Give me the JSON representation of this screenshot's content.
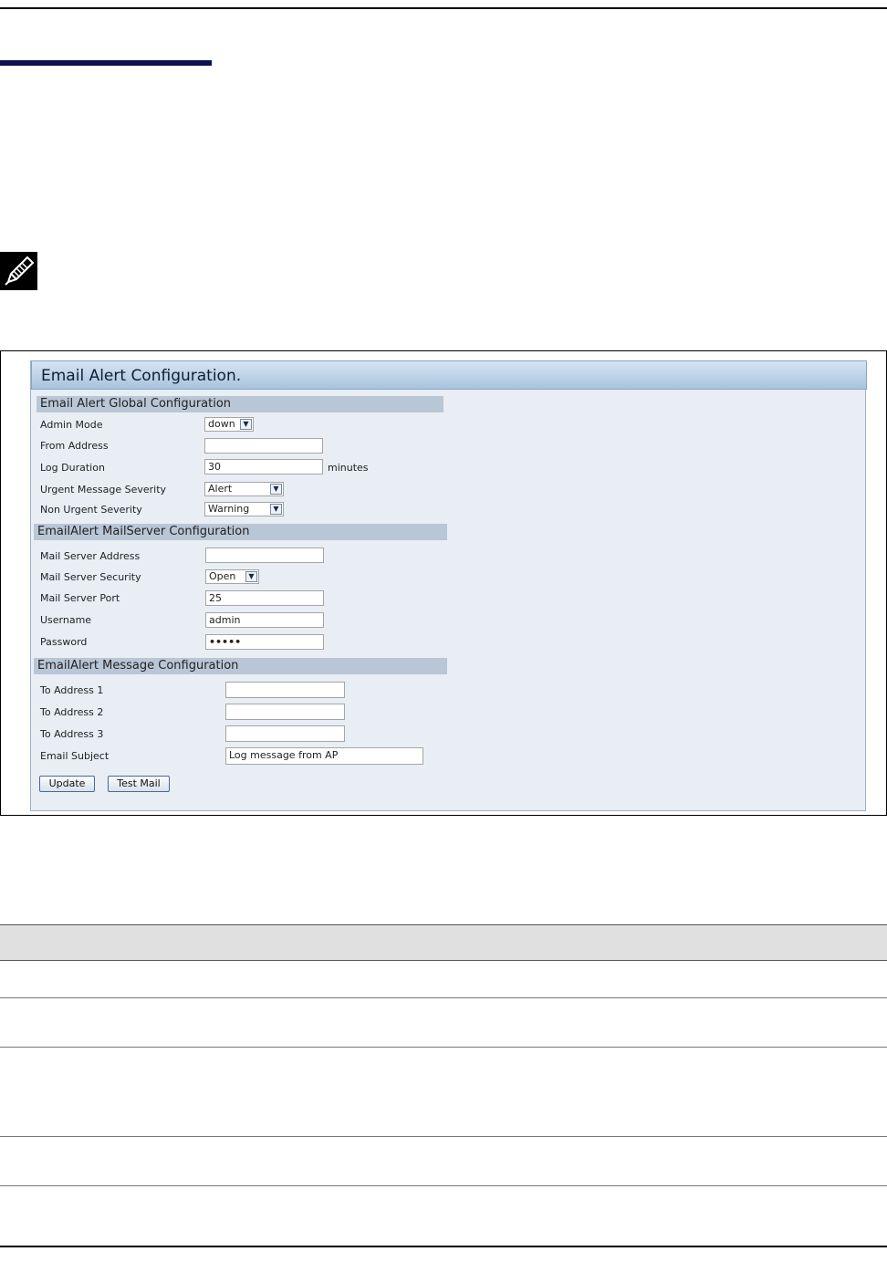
{
  "panel": {
    "title": "Email Alert Configuration."
  },
  "global_config": {
    "heading": "Email Alert Global Configuration",
    "admin_mode": {
      "label": "Admin Mode",
      "value": "down"
    },
    "from_address": {
      "label": "From Address",
      "value": ""
    },
    "log_duration": {
      "label": "Log Duration",
      "value": "30",
      "unit": "minutes"
    },
    "urgent_severity": {
      "label": "Urgent Message Severity",
      "value": "Alert"
    },
    "non_urgent_severity": {
      "label": "Non Urgent Severity",
      "value": "Warning"
    }
  },
  "mailserver_config": {
    "heading": "EmailAlert MailServer Configuration",
    "address": {
      "label": "Mail Server Address",
      "value": ""
    },
    "security": {
      "label": "Mail Server Security",
      "value": "Open"
    },
    "port": {
      "label": "Mail Server Port",
      "value": "25"
    },
    "username": {
      "label": "Username",
      "value": "admin"
    },
    "password": {
      "label": "Password",
      "value": "•••••"
    }
  },
  "message_config": {
    "heading": "EmailAlert Message Configuration",
    "to1": {
      "label": "To Address 1",
      "value": ""
    },
    "to2": {
      "label": "To Address 2",
      "value": ""
    },
    "to3": {
      "label": "To Address 3",
      "value": ""
    },
    "subject": {
      "label": "Email Subject",
      "value": "Log message from AP"
    }
  },
  "buttons": {
    "update": "Update",
    "test_mail": "Test Mail"
  },
  "icons": {
    "note": "note-pencil-icon",
    "dropdown": "chevron-down-icon"
  },
  "colors": {
    "accent": "#0b1450",
    "section_header": "#b9c6d6",
    "panel_bg": "#e9eef3"
  }
}
